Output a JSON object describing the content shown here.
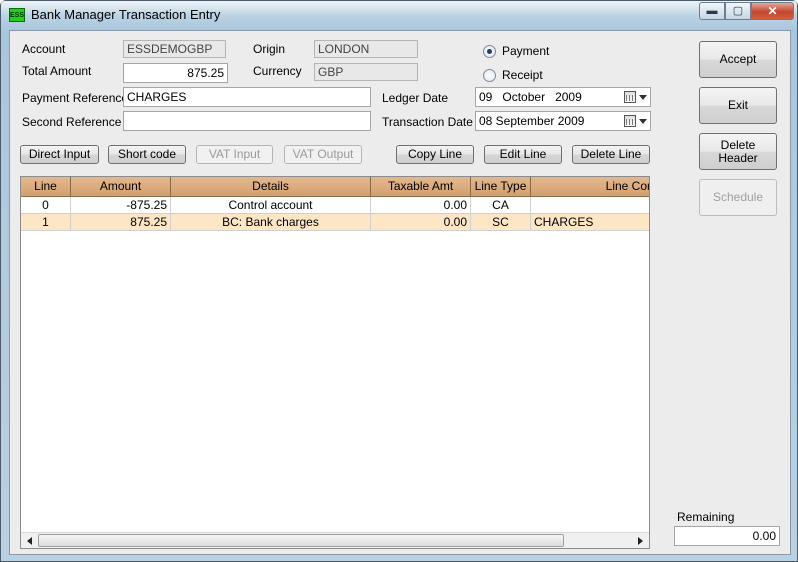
{
  "window": {
    "title": "Bank Manager Transaction Entry",
    "app_icon_text": "ESS",
    "minimize_glyph": "▬",
    "maximize_glyph": "▢",
    "close_glyph": "✕"
  },
  "header": {
    "account_label": "Account",
    "account_value": "ESSDEMOGBP",
    "origin_label": "Origin",
    "origin_value": "LONDON",
    "total_amount_label": "Total Amount",
    "total_amount_value": "875.25",
    "currency_label": "Currency",
    "currency_value": "GBP",
    "payment_reference_label": "Payment Reference",
    "payment_reference_value": "CHARGES",
    "second_reference_label": "Second Reference",
    "second_reference_value": "",
    "ledger_date_label": "Ledger Date",
    "ledger_date": {
      "day": "09",
      "month": "October",
      "year": "2009"
    },
    "transaction_date_label": "Transaction Date",
    "transaction_date_value": "08 September 2009",
    "payment_radio_label": "Payment",
    "receipt_radio_label": "Receipt",
    "selected_type": "Payment"
  },
  "toolbar": {
    "direct_input": "Direct Input",
    "short_code": "Short code",
    "vat_input": "VAT Input",
    "vat_output": "VAT Output",
    "copy_line": "Copy Line",
    "edit_line": "Edit Line",
    "delete_line": "Delete Line"
  },
  "side": {
    "accept": "Accept",
    "exit": "Exit",
    "delete_header_line1": "Delete",
    "delete_header_line2": "Header",
    "schedule": "Schedule"
  },
  "grid": {
    "columns": [
      "Line",
      "Amount",
      "Details",
      "Taxable Amt",
      "Line Type",
      "Line Comm"
    ],
    "rows": [
      {
        "line": "0",
        "amount": "-875.25",
        "details": "Control account",
        "taxable": "0.00",
        "type": "CA",
        "comment": ""
      },
      {
        "line": "1",
        "amount": "875.25",
        "details": "BC: Bank charges",
        "taxable": "0.00",
        "type": "SC",
        "comment": "CHARGES"
      }
    ],
    "selected_row": 1
  },
  "footer": {
    "remaining_label": "Remaining",
    "remaining_value": "0.00"
  },
  "colors": {
    "grid_header": "#d8a878",
    "selected_row": "#fde6c6"
  }
}
